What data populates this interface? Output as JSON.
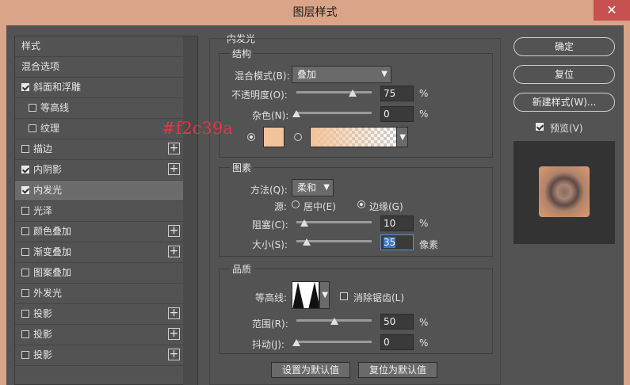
{
  "window": {
    "title": "图层样式",
    "close_glyph": "✕"
  },
  "sidebar": {
    "items": [
      {
        "label": "样式",
        "checkbox": false,
        "checked": false,
        "plus": false,
        "sub": false,
        "active": false
      },
      {
        "label": "混合选项",
        "checkbox": false,
        "checked": false,
        "plus": false,
        "sub": false,
        "active": false
      },
      {
        "label": "斜面和浮雕",
        "checkbox": true,
        "checked": true,
        "plus": false,
        "sub": false,
        "active": false
      },
      {
        "label": "等高线",
        "checkbox": true,
        "checked": false,
        "plus": false,
        "sub": true,
        "active": false
      },
      {
        "label": "纹理",
        "checkbox": true,
        "checked": false,
        "plus": false,
        "sub": true,
        "active": false
      },
      {
        "label": "描边",
        "checkbox": true,
        "checked": false,
        "plus": true,
        "sub": false,
        "active": false
      },
      {
        "label": "内阴影",
        "checkbox": true,
        "checked": true,
        "plus": true,
        "sub": false,
        "active": false
      },
      {
        "label": "内发光",
        "checkbox": true,
        "checked": true,
        "plus": false,
        "sub": false,
        "active": true
      },
      {
        "label": "光泽",
        "checkbox": true,
        "checked": false,
        "plus": false,
        "sub": false,
        "active": false
      },
      {
        "label": "颜色叠加",
        "checkbox": true,
        "checked": false,
        "plus": true,
        "sub": false,
        "active": false
      },
      {
        "label": "渐变叠加",
        "checkbox": true,
        "checked": false,
        "plus": true,
        "sub": false,
        "active": false
      },
      {
        "label": "图案叠加",
        "checkbox": true,
        "checked": false,
        "plus": false,
        "sub": false,
        "active": false
      },
      {
        "label": "外发光",
        "checkbox": true,
        "checked": false,
        "plus": false,
        "sub": false,
        "active": false
      },
      {
        "label": "投影",
        "checkbox": true,
        "checked": false,
        "plus": true,
        "sub": false,
        "active": false
      },
      {
        "label": "投影",
        "checkbox": true,
        "checked": false,
        "plus": true,
        "sub": false,
        "active": false
      },
      {
        "label": "投影",
        "checkbox": true,
        "checked": false,
        "plus": true,
        "sub": false,
        "active": false
      }
    ]
  },
  "panel": {
    "title": "内发光",
    "structure": {
      "title": "结构",
      "blend_mode_label": "混合模式(B):",
      "blend_mode_value": "叠加",
      "opacity_label": "不透明度(O):",
      "opacity_value": "75",
      "opacity_fraction": 0.75,
      "noise_label": "杂色(N):",
      "noise_value": "0",
      "noise_fraction": 0,
      "percent": "%"
    },
    "elements": {
      "title": "图素",
      "method_label": "方法(Q):",
      "method_value": "柔和",
      "source_label": "源:",
      "source_center": "居中(E)",
      "source_edge": "边缘(G)",
      "choke_label": "阻塞(C):",
      "choke_value": "10",
      "choke_fraction": 0.1,
      "size_label": "大小(S):",
      "size_value": "35",
      "size_unit": "像素",
      "size_fraction": 0.14
    },
    "quality": {
      "title": "品质",
      "contour_label": "等高线:",
      "antialias_label": "消除锯齿(L)",
      "range_label": "范围(R):",
      "range_value": "50",
      "range_fraction": 0.5,
      "jitter_label": "抖动(J):",
      "jitter_value": "0",
      "jitter_fraction": 0
    },
    "make_default": "设置为默认值",
    "reset_default": "复位为默认值"
  },
  "annotation": "#f2c39a",
  "colors": {
    "glow": "#f2c39a",
    "accent": "#d9a487"
  },
  "buttons": {
    "ok": "确定",
    "reset": "复位",
    "new_style": "新建样式(W)...",
    "preview": "预览(V)"
  }
}
